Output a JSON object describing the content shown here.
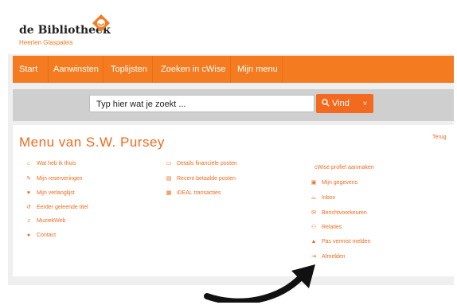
{
  "header": {
    "logo_title": "de Bibliotheek",
    "logo_subtitle": "Heerlen Glaspaleis",
    "brand_color": "#f47b20"
  },
  "nav": {
    "items": [
      "Start",
      "Aanwinsten",
      "Toplijsten",
      "Zoeken in cWise",
      "Mijn menu"
    ]
  },
  "search": {
    "placeholder": "Typ hier wat je zoekt ...",
    "button_label": "Vind",
    "button_caret": "˅"
  },
  "menu": {
    "title": "Menu van S.W. Pursey",
    "back_label": "Terug",
    "col1": [
      {
        "icon": "home-icon",
        "label": "Wat heb ik thuis"
      },
      {
        "icon": "reserve-icon",
        "label": "Mijn reserveringen"
      },
      {
        "icon": "heart-icon",
        "label": "Mijn verlanglijst"
      },
      {
        "icon": "history-icon",
        "label": "Eerder geleende titel"
      },
      {
        "icon": "music-icon",
        "label": "MuziekWeb"
      },
      {
        "icon": "chat-icon",
        "label": "Contact"
      }
    ],
    "col2": [
      {
        "icon": "card-icon",
        "label": "Details financiële posten"
      },
      {
        "icon": "payment-icon",
        "label": "Recent betaalde posten"
      },
      {
        "icon": "ideal-icon",
        "label": "iDEAL transacties"
      }
    ],
    "col3_header": "cWise profiel aanmaken",
    "col3": [
      {
        "icon": "id-card-icon",
        "label": "Mijn gegevens"
      },
      {
        "icon": "inbox-icon",
        "label": "Inbox"
      },
      {
        "icon": "envelope-icon",
        "label": "Berichtvoorkeuren"
      },
      {
        "icon": "users-icon",
        "label": "Relaties"
      },
      {
        "icon": "warning-icon",
        "label": "Pas vermist melden"
      },
      {
        "icon": "sign-out-icon",
        "label": "Afmelden"
      }
    ]
  }
}
